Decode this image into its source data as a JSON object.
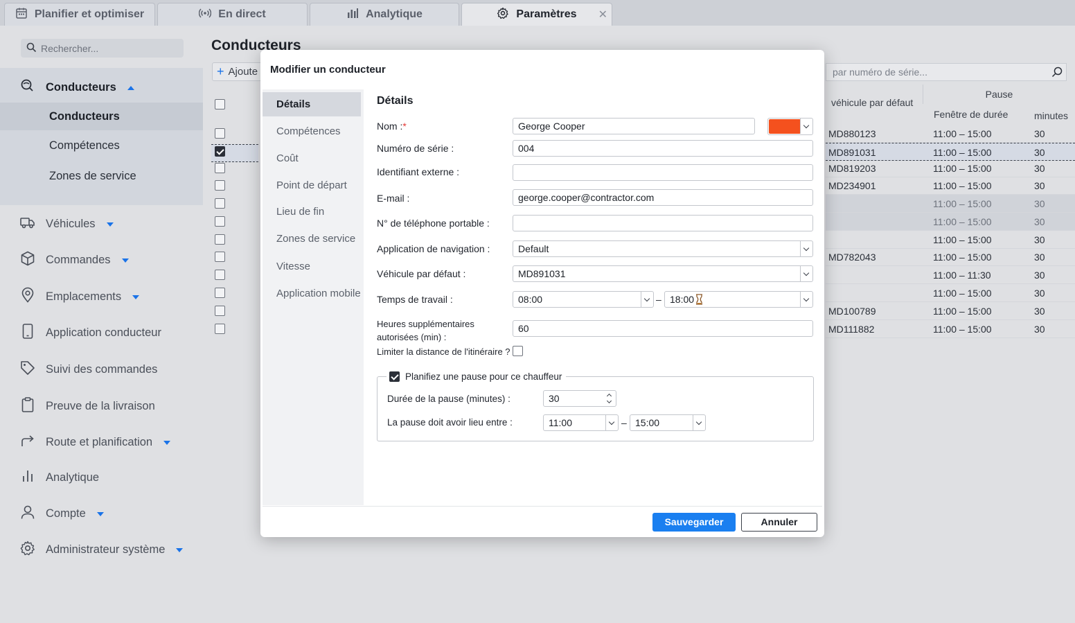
{
  "tabs": [
    {
      "label": "Planifier et optimiser",
      "icon": "calendar-icon"
    },
    {
      "label": "En direct",
      "icon": "broadcast-icon"
    },
    {
      "label": "Analytique",
      "icon": "bar-chart-icon"
    },
    {
      "label": "Paramètres",
      "icon": "gear-icon",
      "active": true
    }
  ],
  "sidebar": {
    "search_placeholder": "Rechercher...",
    "group": {
      "label": "Conducteurs",
      "icon": "drivers-icon",
      "items": [
        {
          "label": "Conducteurs",
          "active": true
        },
        {
          "label": "Compétences"
        },
        {
          "label": "Zones de service"
        }
      ]
    },
    "items": [
      {
        "label": "Véhicules",
        "icon": "truck-icon",
        "expandable": true
      },
      {
        "label": "Commandes",
        "icon": "box-icon",
        "expandable": true
      },
      {
        "label": "Emplacements",
        "icon": "location-pin-icon",
        "expandable": true
      },
      {
        "label": "Application conducteur",
        "icon": "phone-icon",
        "expandable": false
      },
      {
        "label": "Suivi des commandes",
        "icon": "tag-icon",
        "expandable": false
      },
      {
        "label": "Preuve de la livraison",
        "icon": "clipboard-icon",
        "expandable": false
      },
      {
        "label": "Route et planification",
        "icon": "route-icon",
        "expandable": true
      },
      {
        "label": "Analytique",
        "icon": "bar-chart-icon",
        "expandable": false
      },
      {
        "label": "Compte",
        "icon": "user-icon",
        "expandable": true
      },
      {
        "label": "Administrateur système",
        "icon": "gear-icon",
        "expandable": true
      }
    ]
  },
  "page": {
    "title": "Conducteurs",
    "add_label": "Ajoute",
    "search_placeholder": "par numéro de série...",
    "table": {
      "col_vehicle": "véhicule par défaut",
      "col_pause": "Pause",
      "col_window": "Fenêtre de durée",
      "col_minutes": "minutes",
      "rows": [
        {
          "vehicle": "MD880123",
          "window": "11:00 – 15:00",
          "minutes": "30",
          "checked": false,
          "state": ""
        },
        {
          "vehicle": "MD891031",
          "window": "11:00 – 15:00",
          "minutes": "30",
          "checked": true,
          "state": "sel"
        },
        {
          "vehicle": "MD819203",
          "window": "11:00 – 15:00",
          "minutes": "30",
          "checked": false,
          "state": ""
        },
        {
          "vehicle": "MD234901",
          "window": "11:00 – 15:00",
          "minutes": "30",
          "checked": false,
          "state": ""
        },
        {
          "vehicle": "",
          "window": "11:00 – 15:00",
          "minutes": "30",
          "checked": false,
          "state": "shade"
        },
        {
          "vehicle": "",
          "window": "11:00 – 15:00",
          "minutes": "30",
          "checked": false,
          "state": "shade"
        },
        {
          "vehicle": "",
          "window": "11:00 – 15:00",
          "minutes": "30",
          "checked": false,
          "state": ""
        },
        {
          "vehicle": "MD782043",
          "window": "11:00 – 15:00",
          "minutes": "30",
          "checked": false,
          "state": ""
        },
        {
          "vehicle": "",
          "window": "11:00 – 11:30",
          "minutes": "30",
          "checked": false,
          "state": ""
        },
        {
          "vehicle": "",
          "window": "11:00 – 15:00",
          "minutes": "30",
          "checked": false,
          "state": ""
        },
        {
          "vehicle": "MD100789",
          "window": "11:00 – 15:00",
          "minutes": "30",
          "checked": false,
          "state": ""
        },
        {
          "vehicle": "MD111882",
          "window": "11:00 – 15:00",
          "minutes": "30",
          "checked": false,
          "state": ""
        }
      ]
    }
  },
  "modal": {
    "title": "Modifier un conducteur",
    "nav": [
      "Détails",
      "Compétences",
      "Coût",
      "Point de départ",
      "Lieu de fin",
      "Zones de service",
      "Vitesse",
      "Application mobile"
    ],
    "section_title": "Détails",
    "labels": {
      "name": "Nom :",
      "serial": "Numéro de série :",
      "external_id": "Identifiant externe :",
      "email": "E-mail :",
      "mobile": "N° de téléphone portable :",
      "nav_app": "Application de navigation :",
      "default_vehicle": "Véhicule par défaut :",
      "work_time": "Temps de travail :",
      "overtime_line1": "Heures supplémentaires",
      "overtime_line2": "autorisées (min) :",
      "limit_distance": "Limiter la distance de l'itinéraire ?",
      "plan_break": "Planifiez une pause pour ce chauffeur",
      "break_duration": "Durée de la pause (minutes) :",
      "break_between": "La pause doit avoir lieu entre :"
    },
    "values": {
      "name": "George Cooper",
      "color": "#f4511e",
      "serial": "004",
      "external_id": "",
      "email": "george.cooper@contractor.com",
      "mobile": "",
      "nav_app": "Default",
      "default_vehicle": "MD891031",
      "work_start": "08:00",
      "work_end": "18:00",
      "overtime": "60",
      "limit_distance": false,
      "plan_break": true,
      "break_duration": "30",
      "break_start": "11:00",
      "break_end": "15:00"
    },
    "save_label": "Sauvegarder",
    "cancel_label": "Annuler"
  }
}
